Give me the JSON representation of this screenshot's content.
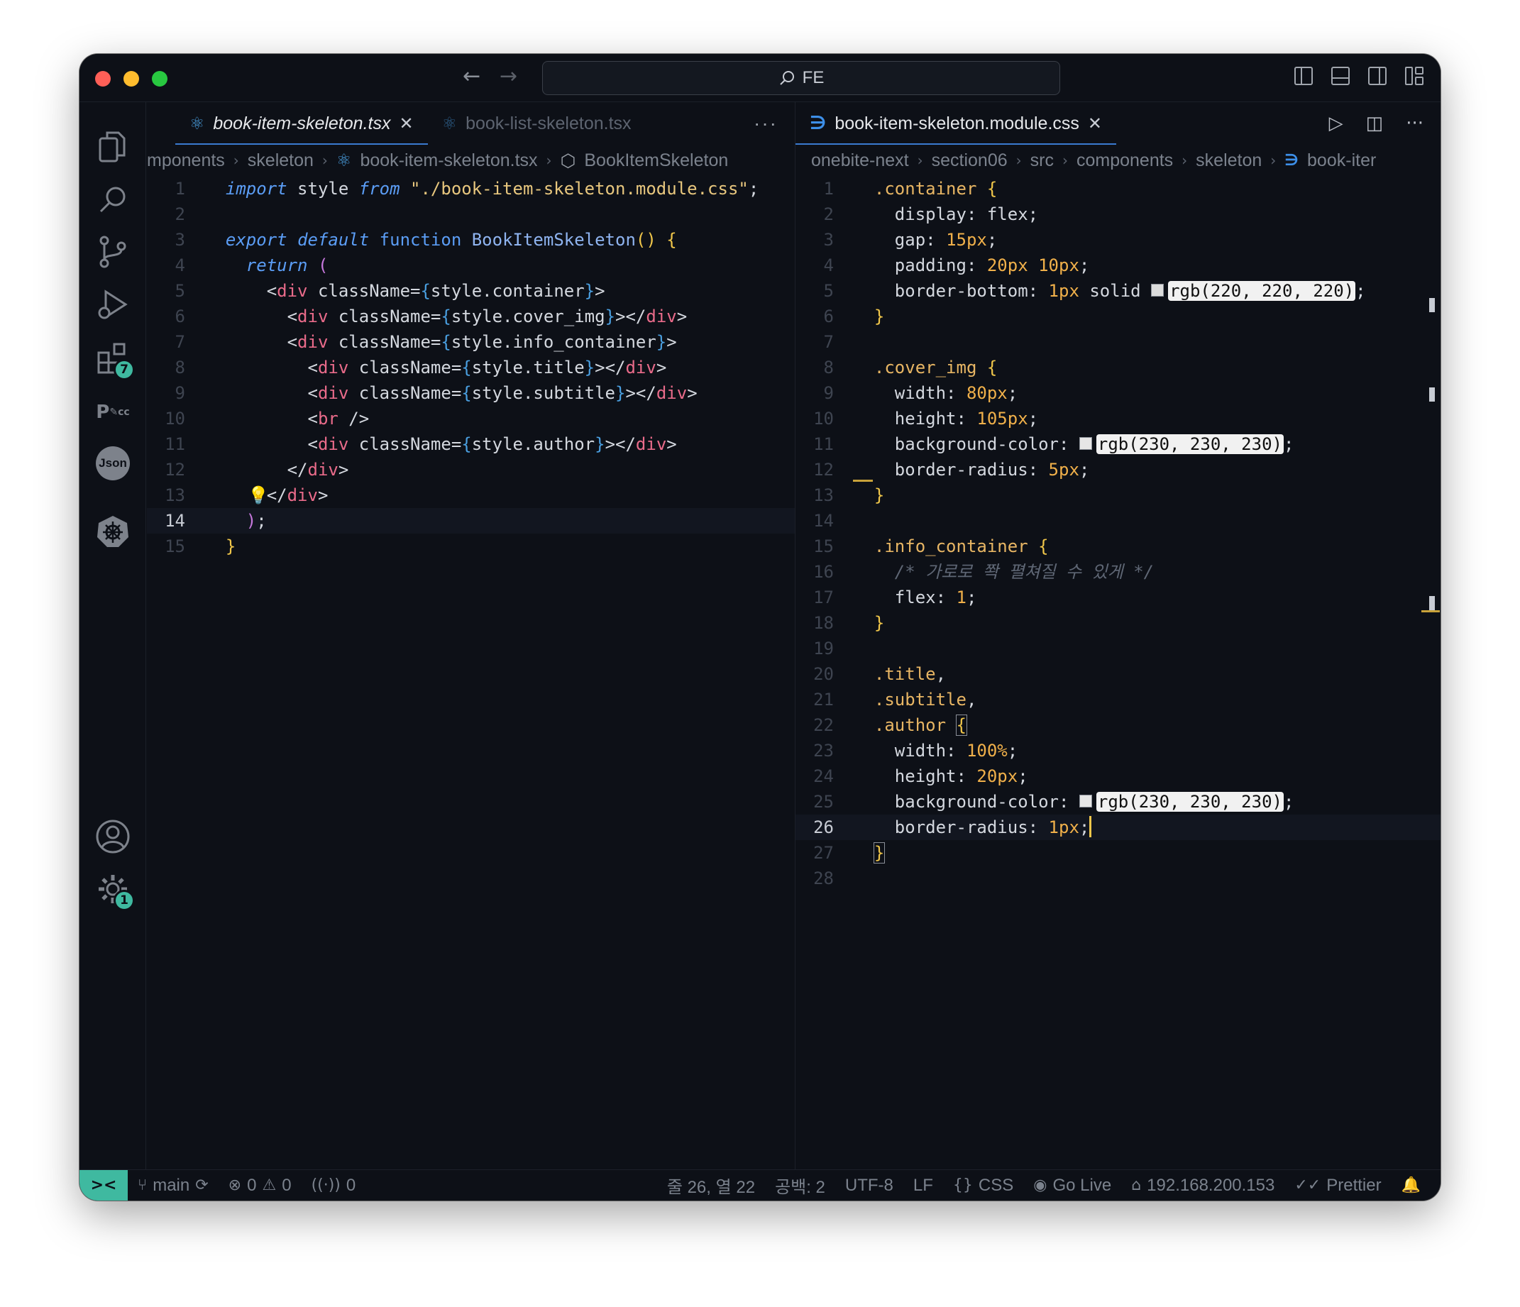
{
  "titlebar": {
    "search_text": "FE",
    "back_icon": "arrow-left-icon",
    "forward_icon": "arrow-right-icon"
  },
  "activity_bar": {
    "extensions_badge": "7",
    "settings_badge": "1"
  },
  "left_editor": {
    "tabs": [
      {
        "label": "book-item-skeleton.tsx",
        "active": true
      },
      {
        "label": "book-list-skeleton.tsx",
        "active": false
      }
    ],
    "more_label": "···",
    "breadcrumb": [
      "mponents",
      "skeleton",
      "book-item-skeleton.tsx",
      "BookItemSkeleton"
    ],
    "current_line": 14
  },
  "right_editor": {
    "tabs": [
      {
        "label": "book-item-skeleton.module.css",
        "active": true
      }
    ],
    "more_label": "···",
    "breadcrumb": [
      "onebite-next",
      "section06",
      "src",
      "components",
      "skeleton",
      "book-iter"
    ],
    "current_line": 26
  },
  "statusbar": {
    "branch": "main",
    "errors": "0",
    "warnings": "0",
    "ports": "0",
    "position": "줄 26, 열 22",
    "indent": "공백: 2",
    "encoding": "UTF-8",
    "eol": "LF",
    "language": "CSS",
    "golive": "Go Live",
    "ip": "192.168.200.153",
    "formatter": "Prettier"
  },
  "colors": {
    "background": "#0d1017",
    "accent": "#3fb9a0",
    "keyword": "#5b9df5",
    "string": "#e8c77e",
    "tag": "#e96b8a",
    "number": "#f0b04a"
  }
}
